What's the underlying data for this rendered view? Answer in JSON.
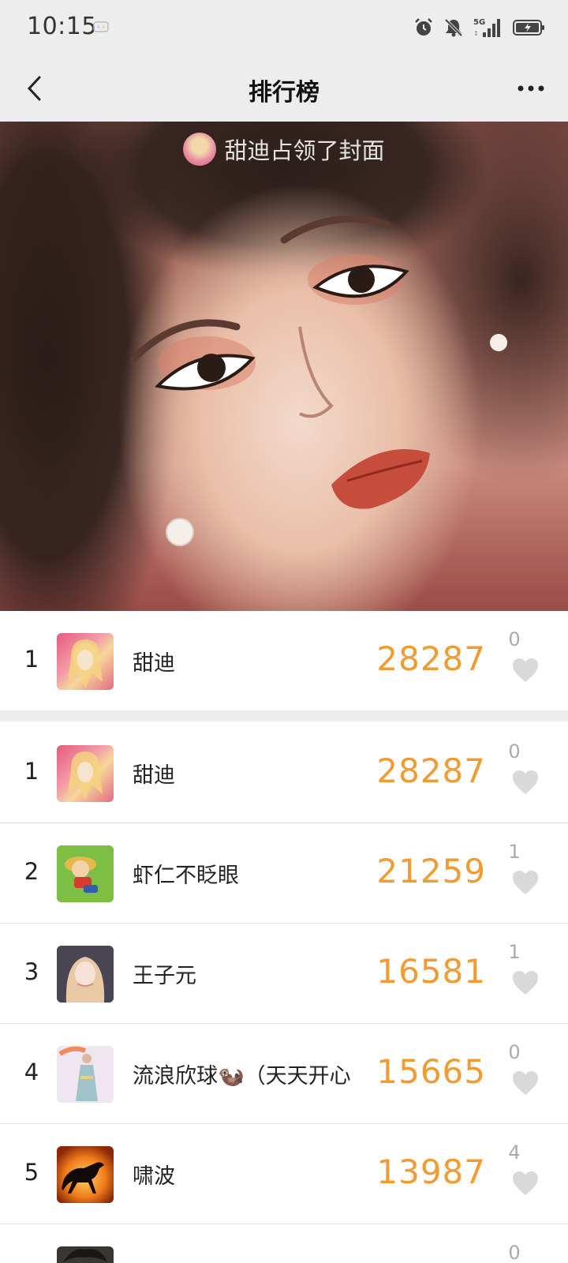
{
  "status_bar": {
    "time": "10:15",
    "network": "5G",
    "icons": [
      "alarm-icon",
      "mute-icon",
      "signal-icon",
      "battery-icon"
    ]
  },
  "nav": {
    "title": "排行榜",
    "back_icon": "chevron-left-icon",
    "more_icon": "more-horizontal-icon"
  },
  "cover": {
    "caption": "甜迪占领了封面"
  },
  "my_rank": {
    "rank": "1",
    "name": "甜迪",
    "steps": "28287",
    "likes": "0"
  },
  "leaderboard": [
    {
      "rank": "1",
      "name": "甜迪",
      "steps": "28287",
      "likes": "0"
    },
    {
      "rank": "2",
      "name": "虾仁不眨眼",
      "steps": "21259",
      "likes": "1"
    },
    {
      "rank": "3",
      "name": "王子元",
      "steps": "16581",
      "likes": "1"
    },
    {
      "rank": "4",
      "name": "流浪欣球🦦（天天开心",
      "steps": "15665",
      "likes": "0"
    },
    {
      "rank": "5",
      "name": "啸波",
      "steps": "13987",
      "likes": "4"
    },
    {
      "rank": "",
      "name": "",
      "steps": "",
      "likes": "0"
    }
  ],
  "colors": {
    "steps": "#f19b32",
    "header_bg": "#ededed",
    "like_icon": "#d9d9d9"
  }
}
